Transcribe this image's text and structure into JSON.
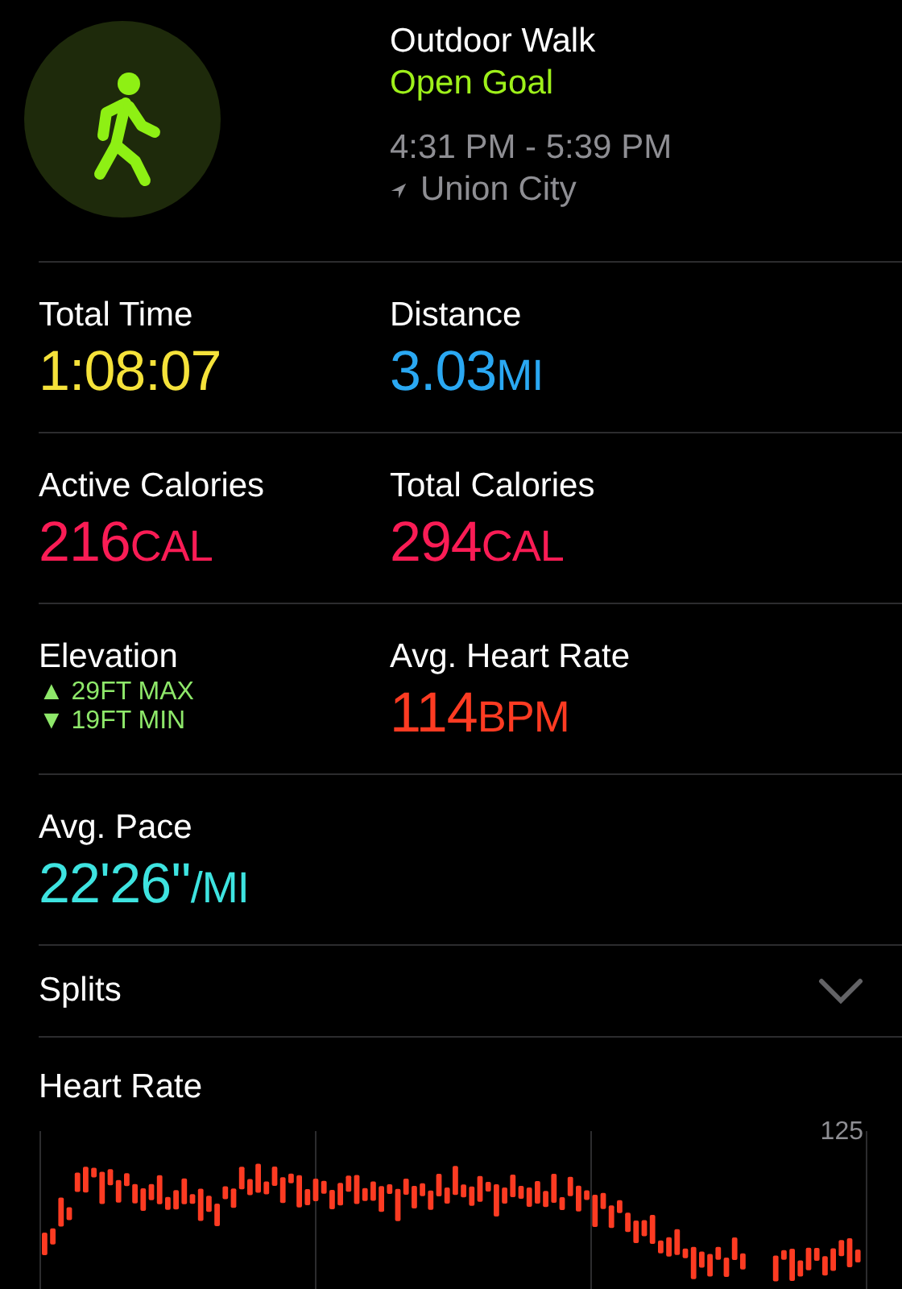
{
  "workout": {
    "title": "Outdoor Walk",
    "goal": "Open Goal",
    "time_range": "4:31 PM - 5:39 PM",
    "location": "Union City"
  },
  "metric_rows": [
    {
      "cells": [
        {
          "kind": "value",
          "label": "Total Time",
          "value": "1:08:07",
          "color": "#f5e23a"
        },
        {
          "kind": "value",
          "label": "Distance",
          "value": "3.03",
          "unit": "MI",
          "color": "#2aa8f2"
        }
      ]
    },
    {
      "cells": [
        {
          "kind": "value",
          "label": "Active Calories",
          "value": "216",
          "unit": "CAL",
          "color": "#fa1c55"
        },
        {
          "kind": "value",
          "label": "Total Calories",
          "value": "294",
          "unit": "CAL",
          "color": "#fa1c55"
        }
      ]
    },
    {
      "cells": [
        {
          "kind": "elevation",
          "label": "Elevation",
          "color": "#8ee86a",
          "lines": [
            {
              "arrow": "▲",
              "text": "29FT MAX"
            },
            {
              "arrow": "▼",
              "text": "19FT MIN"
            }
          ]
        },
        {
          "kind": "value",
          "label": "Avg. Heart Rate",
          "value": "114",
          "unit": "BPM",
          "color": "#fd3b22"
        }
      ]
    },
    {
      "cells": [
        {
          "kind": "value",
          "label": "Avg. Pace",
          "value": "22'26''",
          "unit": "/MI",
          "color": "#3ee3e0"
        }
      ]
    }
  ],
  "splits": {
    "label": "Splits",
    "expanded": false
  },
  "heart_rate": {
    "title": "Heart Rate",
    "max_label": "125"
  }
}
